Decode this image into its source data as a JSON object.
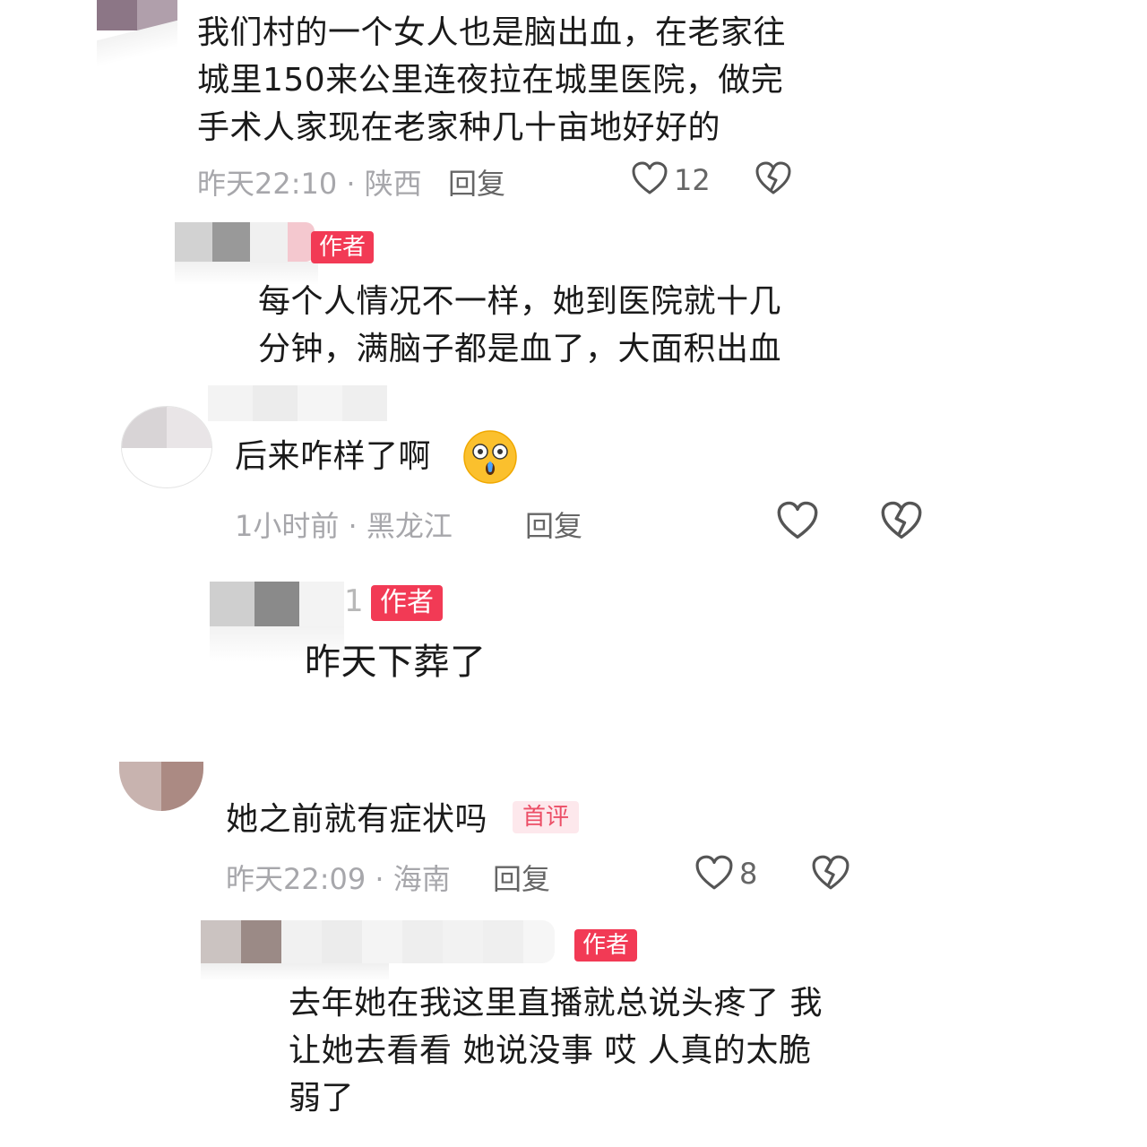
{
  "comments": [
    {
      "text": "我们村的一个女人也是脑出血，在老家往\n城里150来公里连夜拉在城里医院，做完\n手术人家现在老家种几十亩地好好的",
      "time_location": "昨天22:10 · 陕西",
      "reply_label": "回复",
      "likes": "12"
    },
    {
      "author_badge": "作者",
      "text": "每个人情况不一样，她到医院就十几\n分钟，满脑子都是血了，大面积出血"
    },
    {
      "text": "后来咋样了啊",
      "emoji": "shocked-face-emoji",
      "time_location": "1小时前 · 黑龙江",
      "reply_label": "回复"
    },
    {
      "name_fragment": "1",
      "author_badge": "作者",
      "text": "昨天下葬了"
    },
    {
      "text": "她之前就有症状吗",
      "first_badge": "首评",
      "time_location": "昨天22:09 · 海南",
      "reply_label": "回复",
      "likes": "8"
    },
    {
      "author_badge": "作者",
      "text": "去年她在我这里直播就总说头疼了 我\n让她去看看 她说没事 哎 人真的太脆\n弱了"
    }
  ],
  "icons": {
    "like": "heart-outline-icon",
    "dislike": "broken-heart-icon"
  },
  "colors": {
    "author_badge": "#f23a55",
    "first_badge_bg": "#fde8ec",
    "first_badge_text": "#ec4e66",
    "meta_gray": "#a7a7ab"
  }
}
